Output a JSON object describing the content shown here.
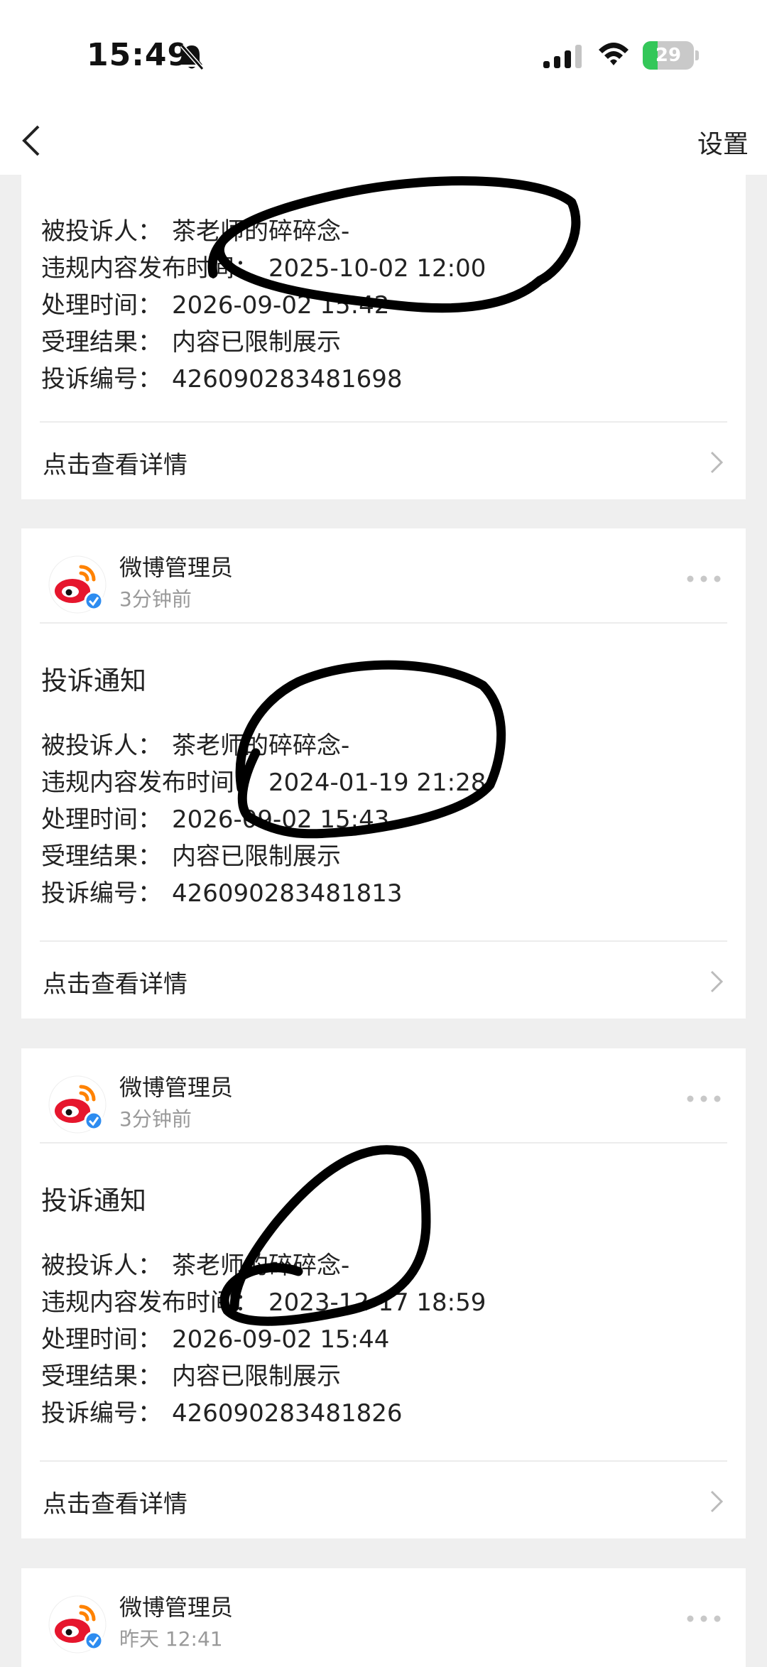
{
  "status_bar": {
    "time": "15:49",
    "battery_level": "29",
    "battery_fraction": 0.29,
    "icons": [
      "bell-muted-icon",
      "cellular-signal-icon",
      "wifi-icon",
      "battery-charging-icon"
    ]
  },
  "nav": {
    "back_icon": "chevron-left-icon",
    "settings_label": "设置"
  },
  "labels": {
    "respondent": "被投诉人：",
    "publish_time": "违规内容发布时间：",
    "process_time": "处理时间：",
    "result": "受理结果：",
    "complaint_id": "投诉编号：",
    "details": "点击查看详情"
  },
  "cards": [
    {
      "respondent": "茶老师的碎碎念-",
      "publish_time": "2025-10-02 12:00",
      "process_time": "2026-09-02 15:42",
      "result": "内容已限制展示",
      "complaint_id": "426090283481698"
    },
    {
      "sender": "微博管理员",
      "time": "3分钟前",
      "title": "投诉通知",
      "respondent": "茶老师的碎碎念-",
      "publish_time": "2024-01-19 21:28",
      "process_time": "2026-09-02 15:43",
      "result": "内容已限制展示",
      "complaint_id": "426090283481813"
    },
    {
      "sender": "微博管理员",
      "time": "3分钟前",
      "title": "投诉通知",
      "respondent": "茶老师的碎碎念-",
      "publish_time": "2023-12-17 18:59",
      "process_time": "2026-09-02 15:44",
      "result": "内容已限制展示",
      "complaint_id": "426090283481826"
    },
    {
      "sender": "微博管理员",
      "time": "昨天 12:41"
    }
  ],
  "colors": {
    "background": "#efefef",
    "card": "#ffffff",
    "weibo_red": "#e6162d",
    "weibo_orange": "#ff8200",
    "verified_blue": "#2d8cf0",
    "battery_green": "#34c759",
    "scribble": "#000000"
  }
}
